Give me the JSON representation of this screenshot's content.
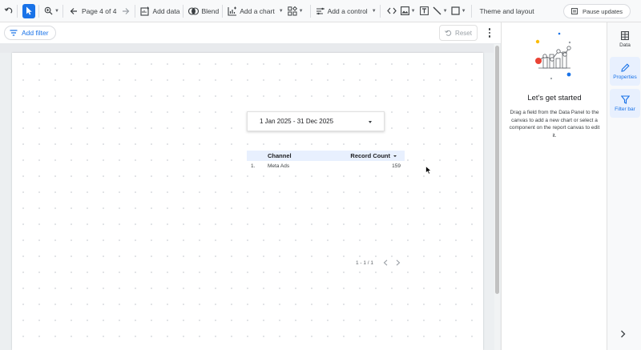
{
  "toolbar": {
    "page_indicator": "Page 4 of 4",
    "add_data": "Add data",
    "blend": "Blend",
    "add_chart": "Add a chart",
    "add_control": "Add a control",
    "theme_layout": "Theme and layout",
    "pause_updates": "Pause updates"
  },
  "filterbar": {
    "add_filter": "Add filter",
    "reset": "Reset"
  },
  "canvas": {
    "date_range": "1 Jan 2025 - 31 Dec 2025",
    "table": {
      "headers": {
        "channel": "Channel",
        "record_count": "Record Count"
      },
      "rows": [
        {
          "index": "1.",
          "channel": "Meta Ads",
          "count": "159"
        }
      ]
    },
    "pagination": "1 - 1 / 1"
  },
  "right_panel": {
    "title": "Let's get started",
    "description": "Drag a field from the Data Panel to the canvas to add a new chart or select a component on the report canvas to edit it."
  },
  "side_rail": {
    "data": "Data",
    "properties": "Properties",
    "filter_bar": "Filter bar"
  },
  "colors": {
    "accent": "#1a73e8",
    "header_bg": "#e8f0fe"
  }
}
